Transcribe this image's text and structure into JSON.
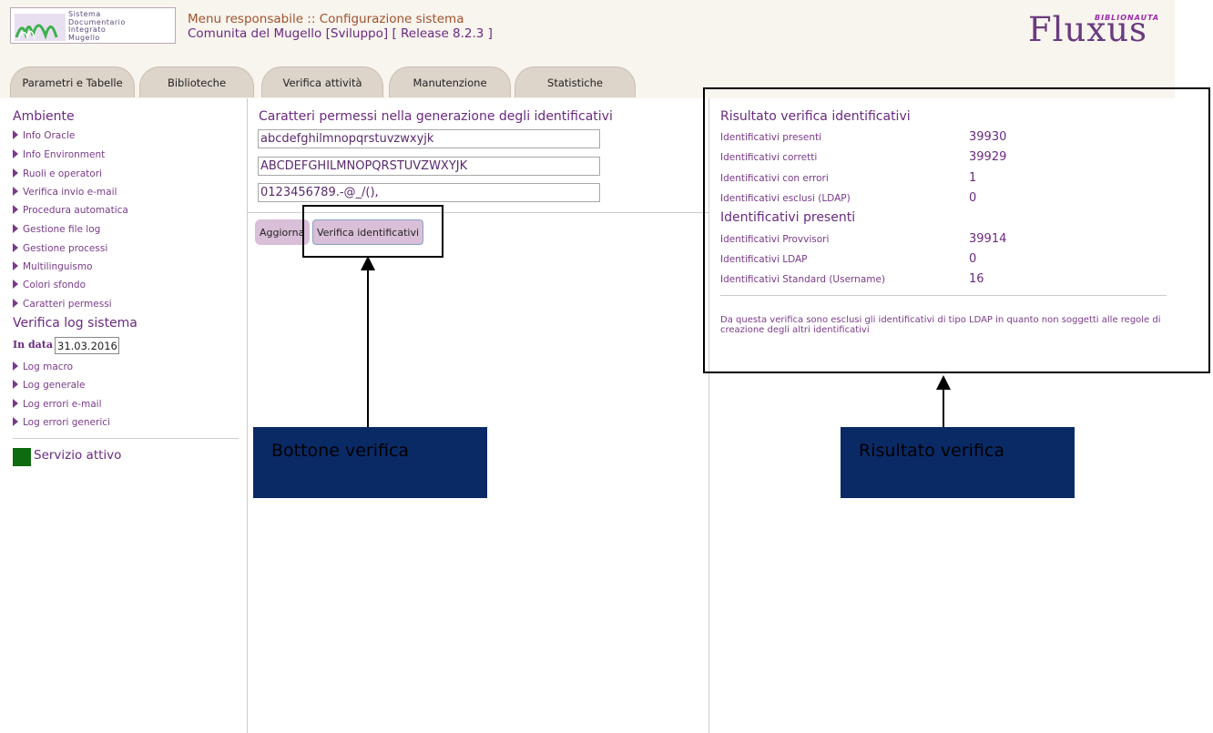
{
  "header": {
    "logo_lines": [
      "Sistema",
      "Documentario",
      "Integrato",
      "Mugello"
    ],
    "title": "Menu responsabile :: Configurazione sistema",
    "subtitle": "Comunita del Mugello [Sviluppo] [ Release 8.2.3 ]",
    "brand": "Fluxus",
    "brand_tag": "BIBLIONAUTA"
  },
  "tabs": [
    {
      "label": "Parametri e Tabelle"
    },
    {
      "label": "Biblioteche"
    },
    {
      "label": "Verifica attività"
    },
    {
      "label": "Manutenzione"
    },
    {
      "label": "Statistiche"
    }
  ],
  "sidebar": {
    "section_ambiente": "Ambiente",
    "ambiente_items": [
      {
        "label": "Info Oracle"
      },
      {
        "label": "Info Environment"
      },
      {
        "label": "Ruoli e operatori"
      },
      {
        "label": "Verifica invio e-mail"
      },
      {
        "label": "Procedura automatica"
      },
      {
        "label": "Gestione file log"
      },
      {
        "label": "Gestione processi"
      },
      {
        "label": "Multilinguismo"
      },
      {
        "label": "Colori sfondo"
      },
      {
        "label": "Caratteri permessi"
      }
    ],
    "section_log": "Verifica log sistema",
    "date_label": "In data",
    "date_value": "31.03.2016",
    "log_items": [
      {
        "label": "Log macro"
      },
      {
        "label": "Log generale"
      },
      {
        "label": "Log errori e-mail"
      },
      {
        "label": "Log errori generici"
      }
    ],
    "status": "Servizio attivo",
    "status_color": "#0e6b0e"
  },
  "middle": {
    "title": "Caratteri permessi nella generazione degli identificativi",
    "lowercase": "abcdefghilmnopqrstuvzwxyjk",
    "uppercase": "ABCDEFGHILMNOPQRSTUVZWXYJK",
    "symbols": "0123456789.-@_/(),",
    "btn_aggiorna": "Aggiorna",
    "btn_verifica": "Verifica identificativi"
  },
  "right": {
    "title_result": "Risultato verifica identificativi",
    "results": [
      {
        "label": "Identificativi presenti",
        "value": "39930"
      },
      {
        "label": "Identificativi corretti",
        "value": "39929"
      },
      {
        "label": "Identificativi con errori",
        "value": "1"
      },
      {
        "label": "Identificativi esclusi (LDAP)",
        "value": "0"
      }
    ],
    "title_present": "Identificativi presenti",
    "present": [
      {
        "label": "Identificativi Provvisori",
        "value": "39914"
      },
      {
        "label": "Identificativi LDAP",
        "value": "0"
      },
      {
        "label": "Identificativi Standard (Username)",
        "value": "16"
      }
    ],
    "note": "Da questa verifica sono esclusi gli identificativi di tipo LDAP in quanto non soggetti alle regole di creazione degli altri identificativi"
  },
  "annotations": {
    "button_callout": "Bottone verifica",
    "result_callout": "Risultato verifica",
    "callout_color": "#0a2a66"
  }
}
